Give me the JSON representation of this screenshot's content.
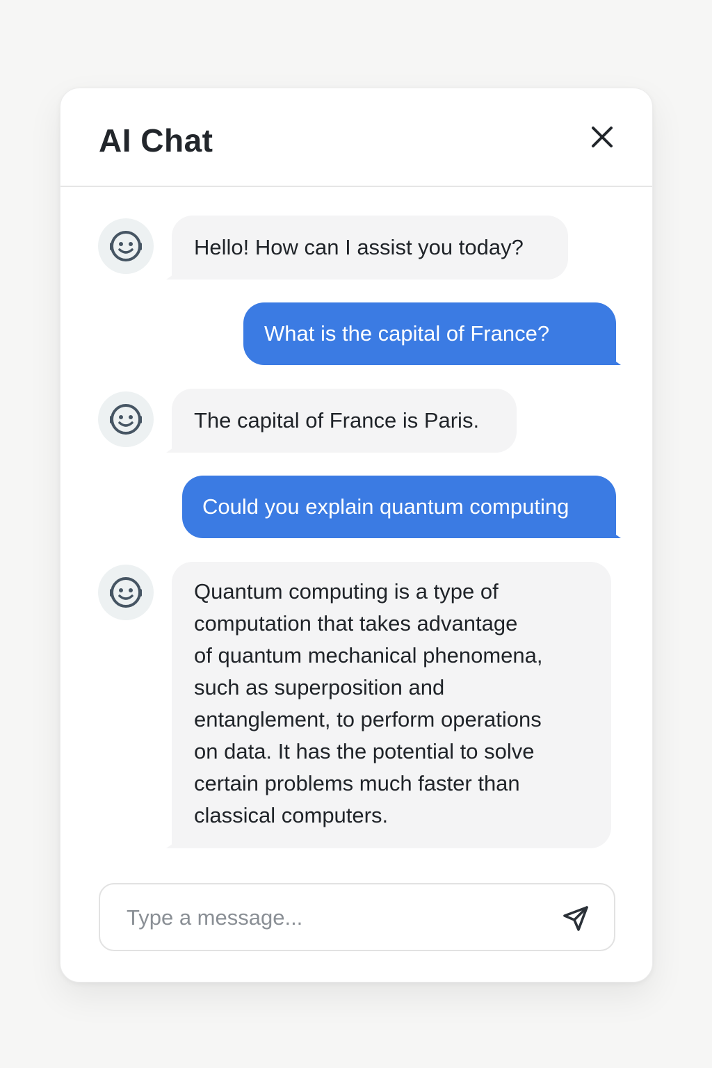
{
  "header": {
    "title": "AI Chat",
    "close_icon": "close-icon"
  },
  "messages": [
    {
      "role": "assistant",
      "text": "Hello! How can I assist you today?",
      "avatar_icon": "bot-face-icon"
    },
    {
      "role": "user",
      "text": "What is the capital of France?"
    },
    {
      "role": "assistant",
      "text": "The capital of France is Paris.",
      "avatar_icon": "bot-face-icon"
    },
    {
      "role": "user",
      "text": "Could you explain quantum computing"
    },
    {
      "role": "assistant",
      "avatar_icon": "bot-face-icon",
      "lines": [
        "Quantum computing is a type of",
        "computation that takes advantage",
        "of quantum mechanical phenomena,",
        "such as superposition and",
        "entanglement, to perform operations",
        "on data. It has the potential to solve",
        "certain problems much faster than",
        "classical computers."
      ]
    }
  ],
  "composer": {
    "placeholder": "Type a message...",
    "value": "",
    "send_icon": "send-icon"
  },
  "colors": {
    "user_bubble": "#3b7be3",
    "bot_bubble": "#f4f4f5",
    "avatar_bg": "#edf1f2",
    "page_bg": "#f6f6f5"
  }
}
